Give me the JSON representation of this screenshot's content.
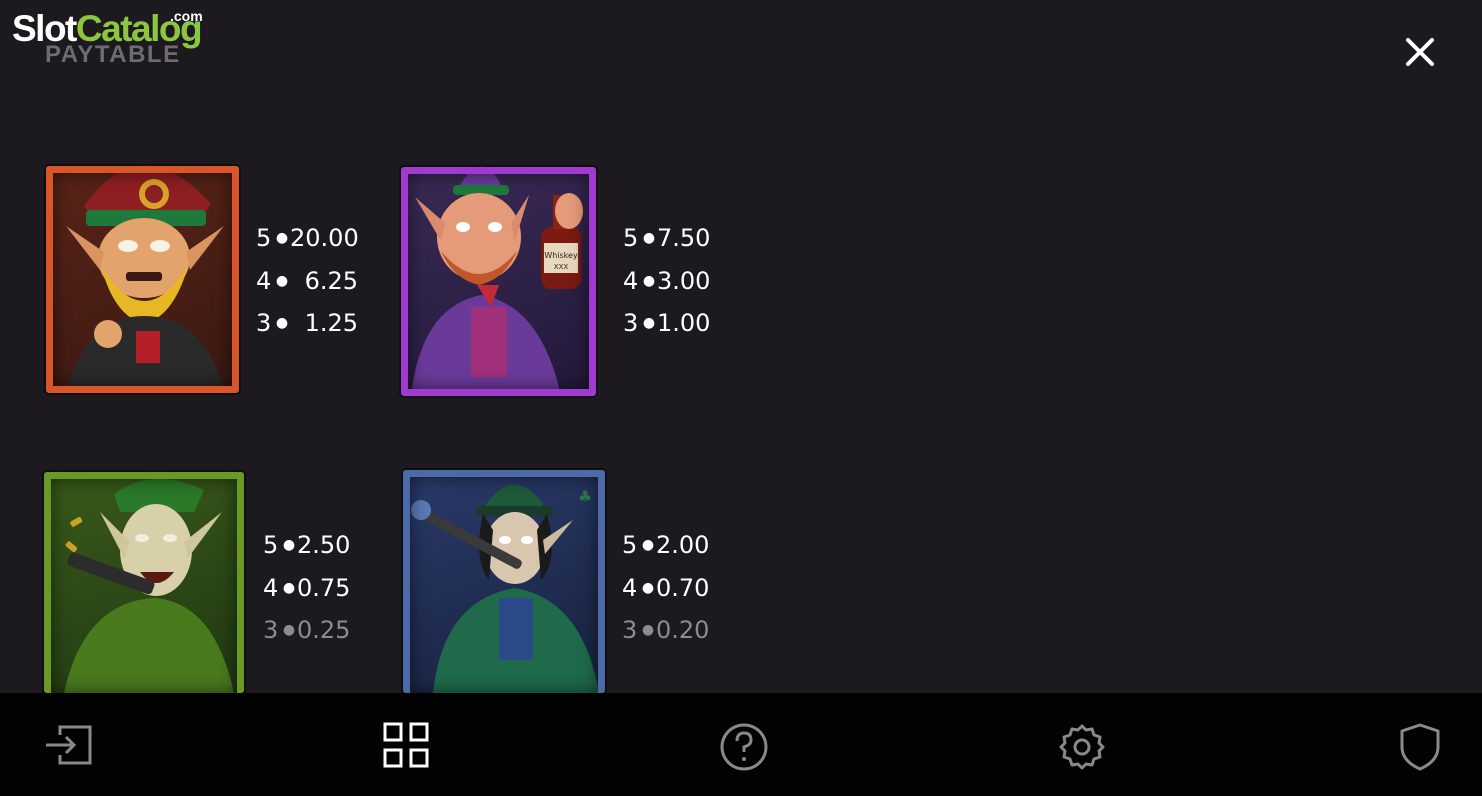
{
  "watermark": {
    "part1": "Slot",
    "part2": "Catalog",
    "suffix": ".com"
  },
  "header": {
    "title": "PAYTABLE"
  },
  "symbols": [
    {
      "name": "red-leprechaun",
      "frame_color": "#d8562a",
      "pays": [
        {
          "count": "5",
          "value": "20.00"
        },
        {
          "count": "4",
          "value": "6.25"
        },
        {
          "count": "3",
          "value": "1.25"
        }
      ]
    },
    {
      "name": "purple-leprechaun-whiskey",
      "frame_color": "#a03ad0",
      "bottle_label": "Whiskey XXX",
      "pays": [
        {
          "count": "5",
          "value": "7.50"
        },
        {
          "count": "4",
          "value": "3.00"
        },
        {
          "count": "3",
          "value": "1.00"
        }
      ]
    },
    {
      "name": "green-leprechaun-gun",
      "frame_color": "#6a9a26",
      "pays": [
        {
          "count": "5",
          "value": "2.50"
        },
        {
          "count": "4",
          "value": "0.75"
        },
        {
          "count": "3",
          "value": "0.25"
        }
      ]
    },
    {
      "name": "blue-leprechaun-cane",
      "frame_color": "#4c6aa8",
      "pays": [
        {
          "count": "5",
          "value": "2.00"
        },
        {
          "count": "4",
          "value": "0.70"
        },
        {
          "count": "3",
          "value": "0.20"
        }
      ]
    }
  ],
  "bottom_nav": [
    {
      "icon": "exit-icon"
    },
    {
      "icon": "grid-icon"
    },
    {
      "icon": "help-icon"
    },
    {
      "icon": "gear-icon"
    },
    {
      "icon": "shield-icon"
    }
  ],
  "colors": {
    "background": "#1c1a1f",
    "bottom_bar": "#020202",
    "title": "#6e6c72",
    "dim_text": "#8d8b91",
    "watermark_green": "#8cc63e"
  }
}
